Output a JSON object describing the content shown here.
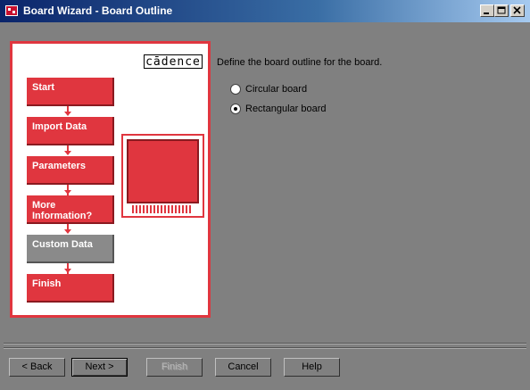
{
  "window": {
    "title": "Board Wizard - Board Outline",
    "icon": "app-icon",
    "controls": [
      "minimize-icon",
      "maximize-icon",
      "close-icon"
    ]
  },
  "panel": {
    "logo": "cādence",
    "steps": [
      {
        "label": "Start",
        "state": "active"
      },
      {
        "label": "Import Data",
        "state": "active"
      },
      {
        "label": "Parameters",
        "state": "active"
      },
      {
        "label": "More\nInformation?",
        "state": "active"
      },
      {
        "label": "Custom Data",
        "state": "inactive"
      },
      {
        "label": "Finish",
        "state": "active"
      }
    ],
    "accent": "#e0363f",
    "inactive_color": "#8a8a8a"
  },
  "instruction": "Define the board outline for the board.",
  "options": [
    {
      "label": "Circular board",
      "selected": false
    },
    {
      "label": "Rectangular board",
      "selected": true
    }
  ],
  "buttons": {
    "back": "< Back",
    "next": "Next >",
    "finish": "Finish",
    "cancel": "Cancel",
    "help": "Help"
  }
}
